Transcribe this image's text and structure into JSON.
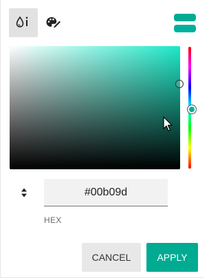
{
  "modes": {
    "drop_mode_icon": "color-mode-drop-icon",
    "palette_mode_icon": "palette-icon",
    "active": "drop"
  },
  "preview": {
    "original_color": "#00ab92",
    "new_color": "#00b09d"
  },
  "picker": {
    "hue_color": "#1de9c8",
    "hue_gradient": [
      "#ff0000",
      "#ff00ff",
      "#0000ff",
      "#00ffff",
      "#00ff00",
      "#ffff00",
      "#ff0000"
    ]
  },
  "input": {
    "format_toggle_icon": "sort-arrows-icon",
    "hex_value": "#00b09d",
    "label": "HEX"
  },
  "buttons": {
    "cancel": "CANCEL",
    "apply": "APPLY"
  },
  "colors": {
    "accent": "#00ab92",
    "mode_active_bg": "#e2e2e2",
    "input_bg": "#f2f2f2"
  }
}
